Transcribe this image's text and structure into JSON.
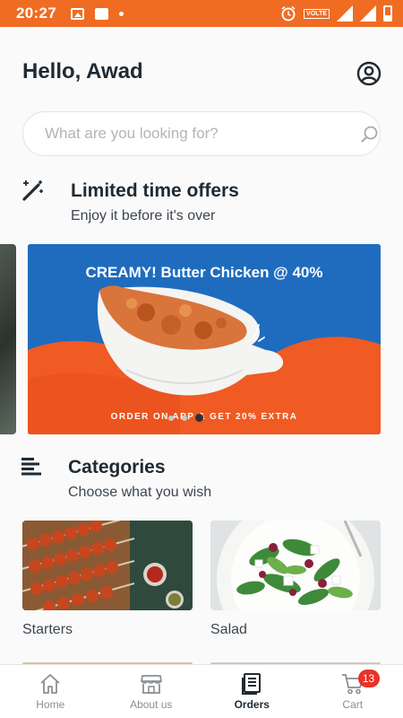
{
  "status_bar": {
    "time": "20:27",
    "network_badge": "VOLTE"
  },
  "header": {
    "greeting": "Hello, Awad",
    "profile_icon": "account-circle-icon"
  },
  "search": {
    "placeholder": "What are you looking for?",
    "value": "",
    "icon": "search-icon"
  },
  "offers": {
    "icon": "magic-wand-icon",
    "title": "Limited time offers",
    "subtitle": "Enjoy it before it's over",
    "banner": {
      "headline": "CREAMY! Butter Chicken @ 40%",
      "footer": "ORDER ON APP & GET 20% EXTRA",
      "colors": {
        "blue": "#1f6cbf",
        "orange": "#f05a23"
      }
    },
    "carousel": {
      "count": 3,
      "active_index": 2
    }
  },
  "categories": {
    "icon": "menu-lines-icon",
    "title": "Categories",
    "subtitle": "Choose what you wish",
    "items": [
      {
        "label": "Starters"
      },
      {
        "label": "Salad"
      }
    ]
  },
  "bottom_nav": {
    "items": [
      {
        "label": "Home",
        "icon": "home-icon",
        "active": false
      },
      {
        "label": "About us",
        "icon": "store-icon",
        "active": false
      },
      {
        "label": "Orders",
        "icon": "orders-list-icon",
        "active": true
      },
      {
        "label": "Cart",
        "icon": "cart-icon",
        "active": false,
        "badge": "13"
      }
    ]
  },
  "colors": {
    "accent": "#ef6c22",
    "badge": "#e8322a",
    "text_dark": "#1f2a33",
    "text_muted": "#8a8f94"
  }
}
